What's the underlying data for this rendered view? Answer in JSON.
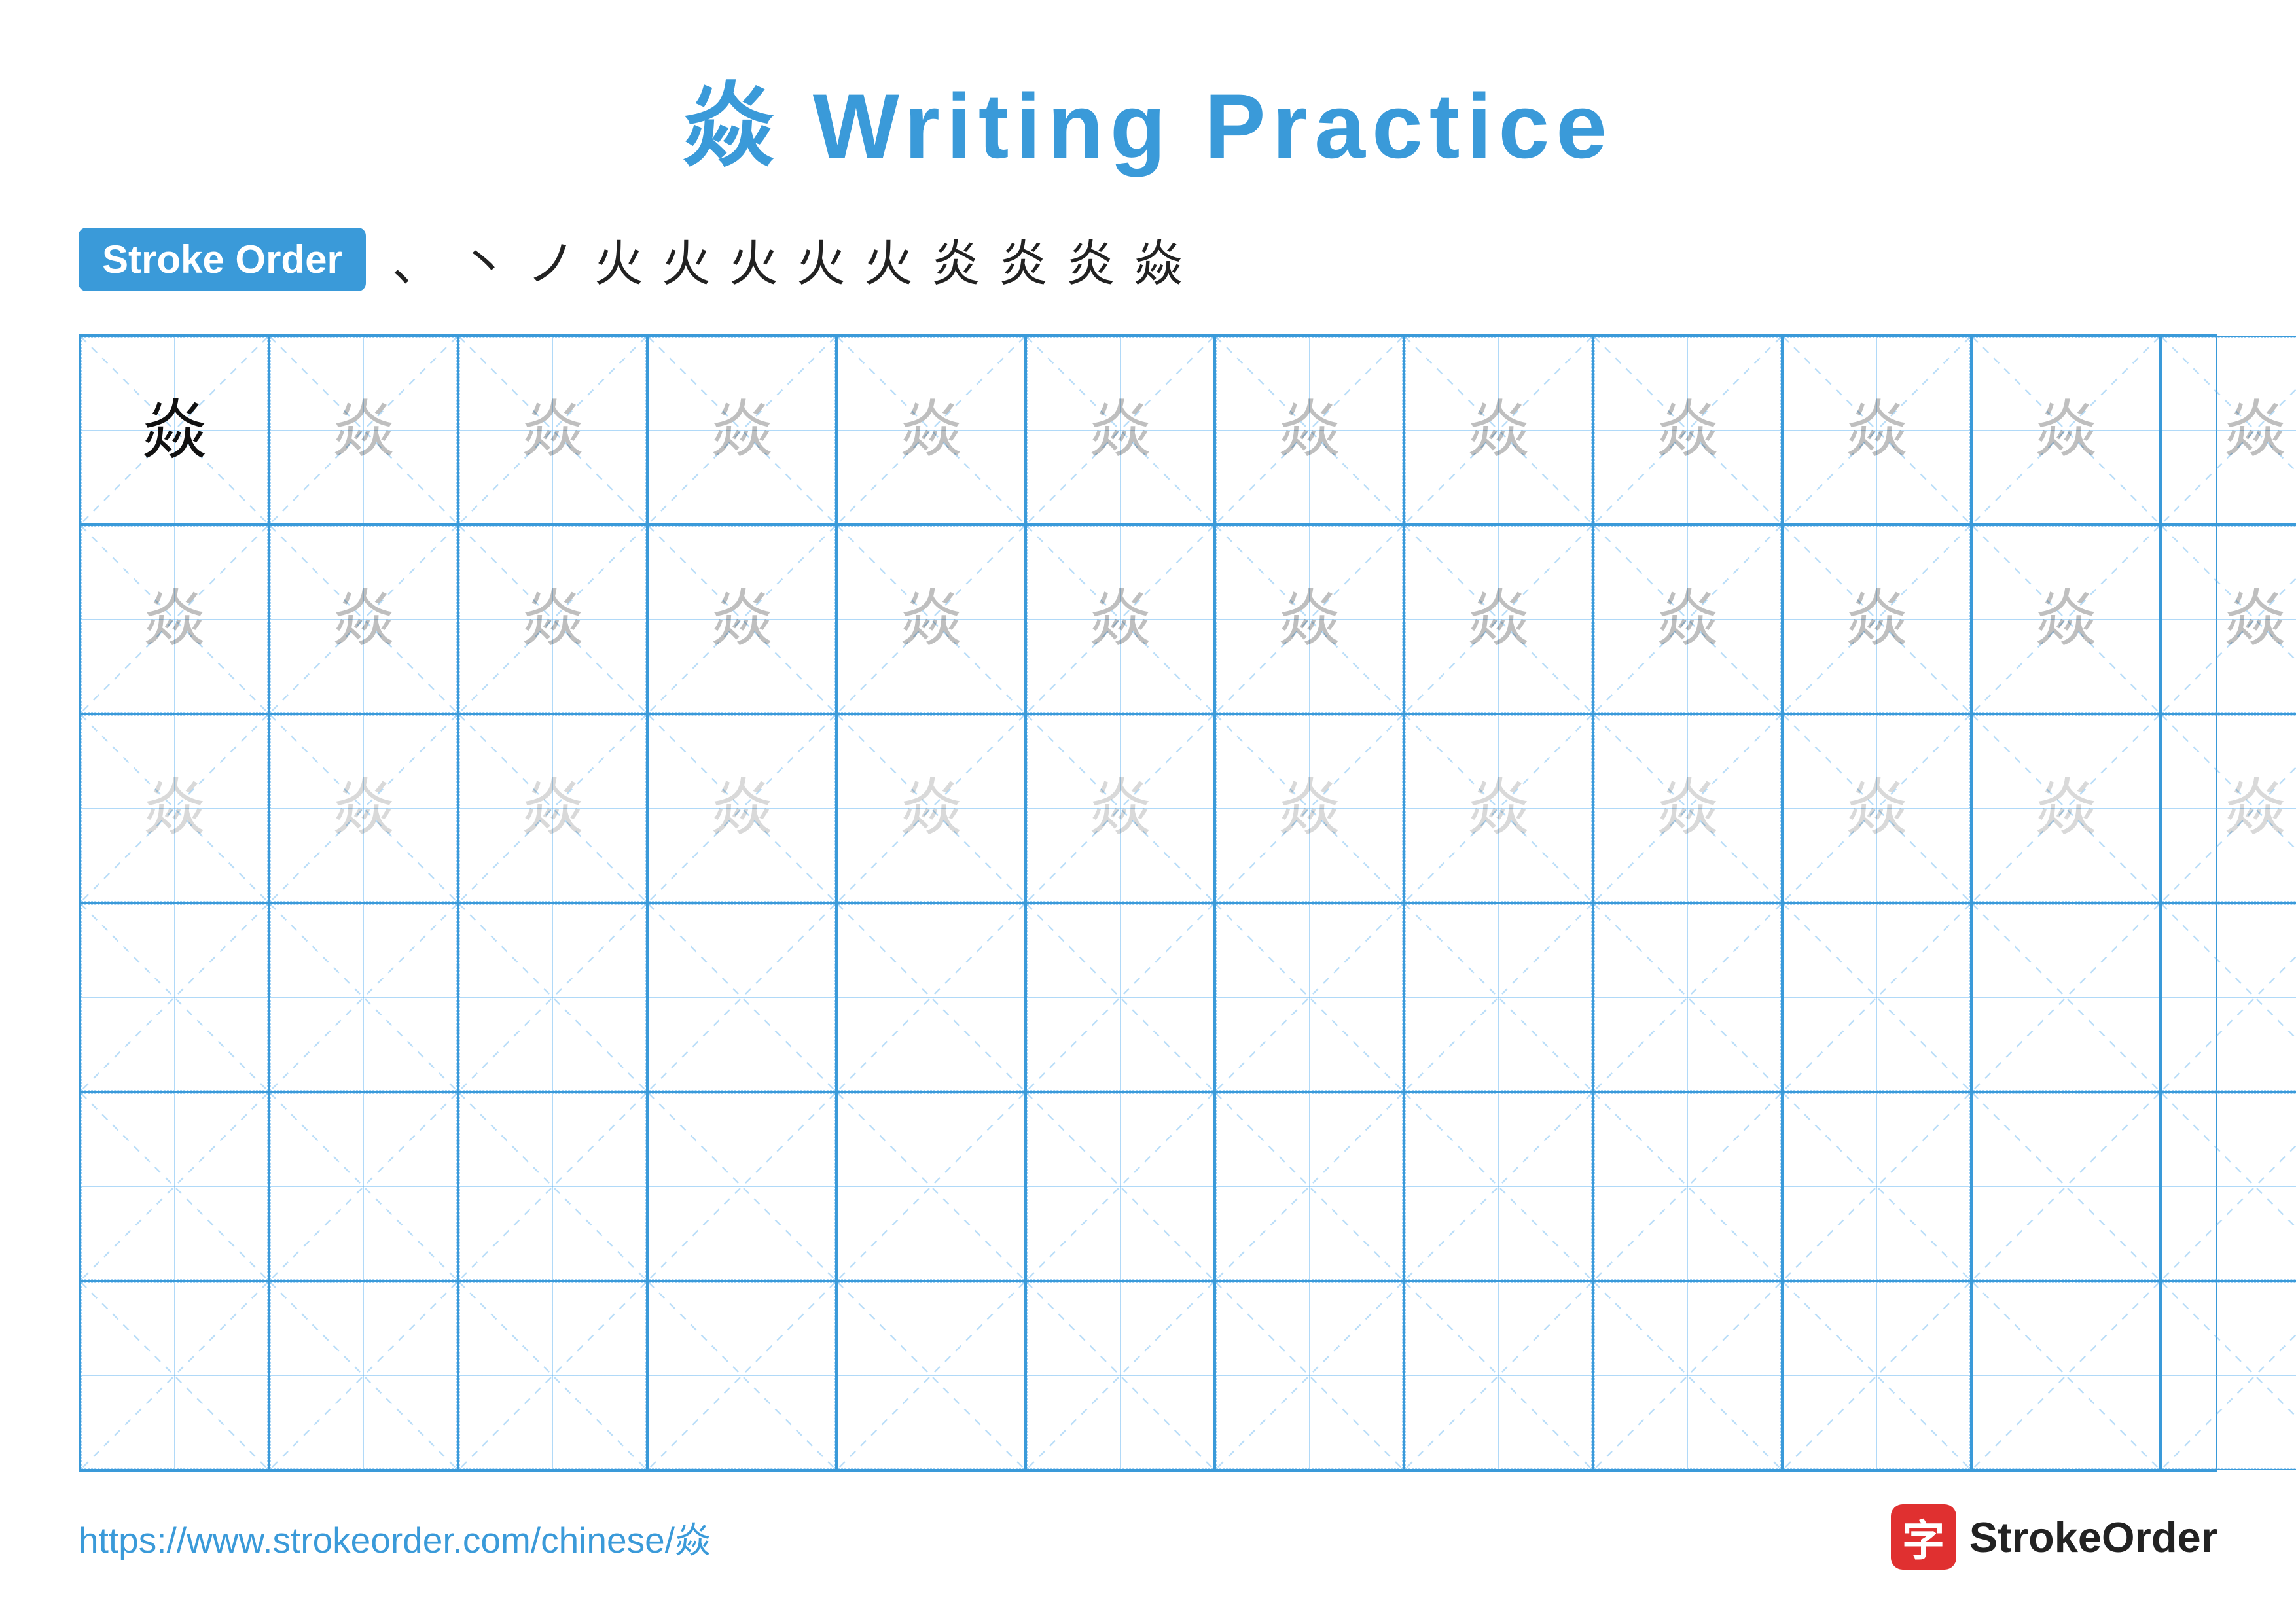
{
  "title": {
    "char": "焱",
    "label": "Writing Practice",
    "full": "焱 Writing Practice"
  },
  "stroke_order": {
    "badge_label": "Stroke Order",
    "strokes": [
      "、",
      "丶",
      "ノ",
      "火",
      "火",
      "火",
      "火",
      "火",
      "炎",
      "炎",
      "炎",
      "焱"
    ]
  },
  "grid": {
    "cols": 13,
    "rows": 6,
    "char": "焱",
    "row1_first": "dark",
    "row1_rest": "medium",
    "row2_all": "medium",
    "row3_all": "light",
    "rows456": "empty"
  },
  "footer": {
    "url": "https://www.strokeorder.com/chinese/焱",
    "brand_char": "字",
    "brand_name": "StrokeOrder"
  }
}
